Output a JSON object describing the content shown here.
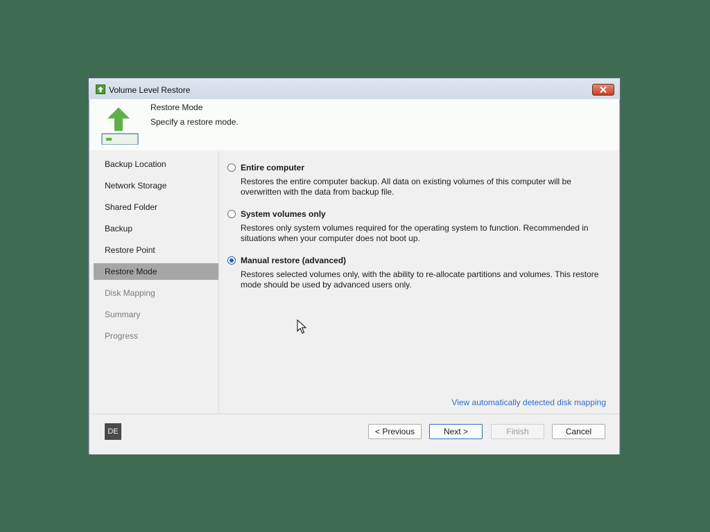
{
  "window": {
    "title": "Volume Level Restore",
    "icon": "restore-app-icon",
    "close_icon": "close-icon"
  },
  "header": {
    "title": "Restore Mode",
    "subtitle": "Specify a restore mode.",
    "icon": "upload-arrow-icon"
  },
  "sidebar": {
    "items": [
      {
        "label": "Backup Location",
        "state": "done"
      },
      {
        "label": "Network Storage",
        "state": "done"
      },
      {
        "label": "Shared Folder",
        "state": "done"
      },
      {
        "label": "Backup",
        "state": "done"
      },
      {
        "label": "Restore Point",
        "state": "done"
      },
      {
        "label": "Restore Mode",
        "state": "active"
      },
      {
        "label": "Disk Mapping",
        "state": "disabled"
      },
      {
        "label": "Summary",
        "state": "disabled"
      },
      {
        "label": "Progress",
        "state": "disabled"
      }
    ]
  },
  "options": [
    {
      "title": "Entire computer",
      "description": "Restores the entire computer backup. All data on existing volumes of this computer will be overwritten with the data from backup file.",
      "checked": false
    },
    {
      "title": "System volumes only",
      "description": "Restores only system volumes required for the operating system to function. Recommended in situations when your computer does not boot up.",
      "checked": false
    },
    {
      "title": "Manual restore (advanced)",
      "description": "Restores selected volumes only, with the ability to re-allocate partitions and volumes. This restore mode should be used by advanced users only.",
      "checked": true
    }
  ],
  "link": {
    "label": "View automatically detected disk mapping"
  },
  "footer": {
    "language": "DE",
    "previous_label": "< Previous",
    "next_label": "Next >",
    "finish_label": "Finish",
    "cancel_label": "Cancel"
  },
  "colors": {
    "background": "#3e6b52",
    "accent": "#2d6fc4",
    "active_nav": "#a6a6a6",
    "brand_green": "#5fb04a"
  }
}
